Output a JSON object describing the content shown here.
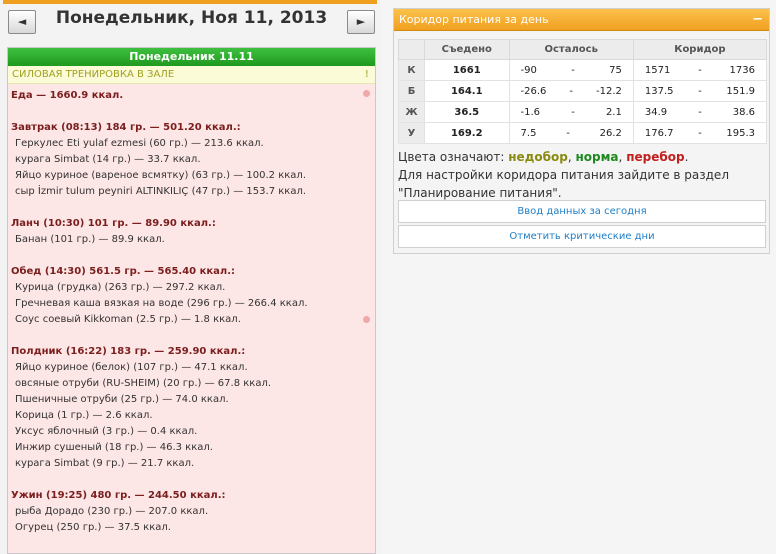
{
  "nav": {
    "prev": "◄",
    "next": "►",
    "date_title": "Понедельник, Ноя 11, 2013"
  },
  "day": {
    "header": "Понедельник 11.11",
    "training": "СИЛОВАЯ ТРЕНИРОВКА В ЗАЛЕ",
    "training_mark": "!",
    "total": "Еда — 1660.9 ккал.",
    "meals": [
      {
        "head": "Завтрак (08:13) 184 гр. — 501.20 ккал.:",
        "items": [
          "Геркулес Eti yulaf ezmesi (60 гр.) — 213.6 ккал.",
          "курага Simbat (14 гр.) — 33.7 ккал.",
          "Яйцо куриное (вареное всмятку) (63 гр.) — 100.2 ккал.",
          "сыр İzmir tulum peyniri ALTINKILIÇ (47 гр.) — 153.7 ккал."
        ]
      },
      {
        "head": "Ланч (10:30) 101 гр. — 89.90 ккал.:",
        "items": [
          "Банан (101 гр.) — 89.9 ккал."
        ]
      },
      {
        "head": "Обед (14:30) 561.5 гр. — 565.40 ккал.:",
        "items": [
          "Курица (грудка) (263 гр.) — 297.2 ккал.",
          "Гречневая каша вязкая на воде (296 гр.) — 266.4 ккал.",
          "Соус соевый Kikkoman (2.5 гр.) — 1.8 ккал."
        ]
      },
      {
        "head": "Полдник (16:22) 183 гр. — 259.90 ккал.:",
        "items": [
          "Яйцо куриное (белок) (107 гр.) — 47.1 ккал.",
          "овсяные отруби (RU-SHEIM) (20 гр.) — 67.8 ккал.",
          "Пшеничные отруби (25 гр.) — 74.0 ккал.",
          "Корица (1 гр.) — 2.6 ккал.",
          "Уксус яблочный (3 гр.) — 0.4 ккал.",
          "Инжир сушеный (18 гр.) — 46.3 ккал.",
          "курага Simbat (9 гр.) — 21.7 ккал."
        ]
      },
      {
        "head": "Ужин (19:25) 480 гр. — 244.50 ккал.:",
        "items": [
          "рыба Дорадо (230 гр.) — 207.0 ккал.",
          "Огурец (250 гр.) — 37.5 ккал."
        ]
      }
    ]
  },
  "corridor": {
    "title": "Коридор питания за день",
    "collapse": "−",
    "columns": [
      "",
      "Съедено",
      "Осталось",
      "Коридор"
    ],
    "dash": "-",
    "rows": [
      {
        "label": "К",
        "eaten": "1661",
        "status": "norm",
        "left_min": "-90",
        "left_max": "75",
        "cor_min": "1571",
        "cor_max": "1736"
      },
      {
        "label": "Б",
        "eaten": "164.1",
        "status": "over",
        "left_min": "-26.6",
        "left_max": "-12.2",
        "cor_min": "137.5",
        "cor_max": "151.9"
      },
      {
        "label": "Ж",
        "eaten": "36.5",
        "status": "norm",
        "left_min": "-1.6",
        "left_max": "2.1",
        "cor_min": "34.9",
        "cor_max": "38.6"
      },
      {
        "label": "У",
        "eaten": "169.2",
        "status": "under",
        "left_min": "7.5",
        "left_max": "26.2",
        "cor_min": "176.7",
        "cor_max": "195.3"
      }
    ],
    "legend": {
      "prefix": "Цвета означают:",
      "under": "недобор",
      "sep1": ",",
      "norm": "норма",
      "sep2": ",",
      "over": "перебор",
      "end": ".",
      "line2": "Для настройки коридора питания зайдите в раздел \"Планирование питания\"."
    },
    "buttons": {
      "enter_today": "Ввод данных за сегодня",
      "mark_critical": "Отметить критические дни"
    },
    "colors": {
      "under": "#8a8a10",
      "norm": "#1e8a1e",
      "over": "#c0201e"
    }
  }
}
